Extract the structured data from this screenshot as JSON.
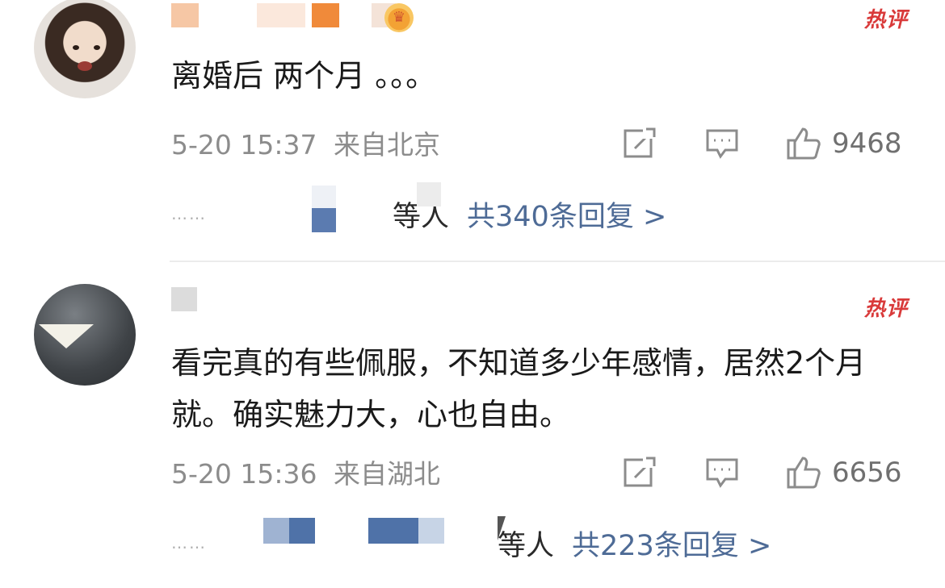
{
  "hot_badge": "热评",
  "comments": [
    {
      "text": "离婚后 两个月 。。。",
      "time": "5-20 15:37",
      "location": "来自北京",
      "likes": "9468",
      "reply_suffix": "等人",
      "reply_count": "共340条回复 >"
    },
    {
      "text": "看完真的有些佩服，不知道多少年感情，居然2个月就。确实魅力大，心也自由。",
      "time": "5-20 15:36",
      "location": "来自湖北",
      "likes": "6656",
      "reply_suffix": "等人",
      "reply_count": "共223条回复 >"
    }
  ],
  "reply_dots": "……",
  "colors": {
    "hot_badge": "#d93a3a",
    "reply_link": "#4e6b96",
    "meta": "#8c8c8c"
  },
  "icons": [
    "repost-icon",
    "comment-icon",
    "like-icon",
    "crown-icon"
  ]
}
